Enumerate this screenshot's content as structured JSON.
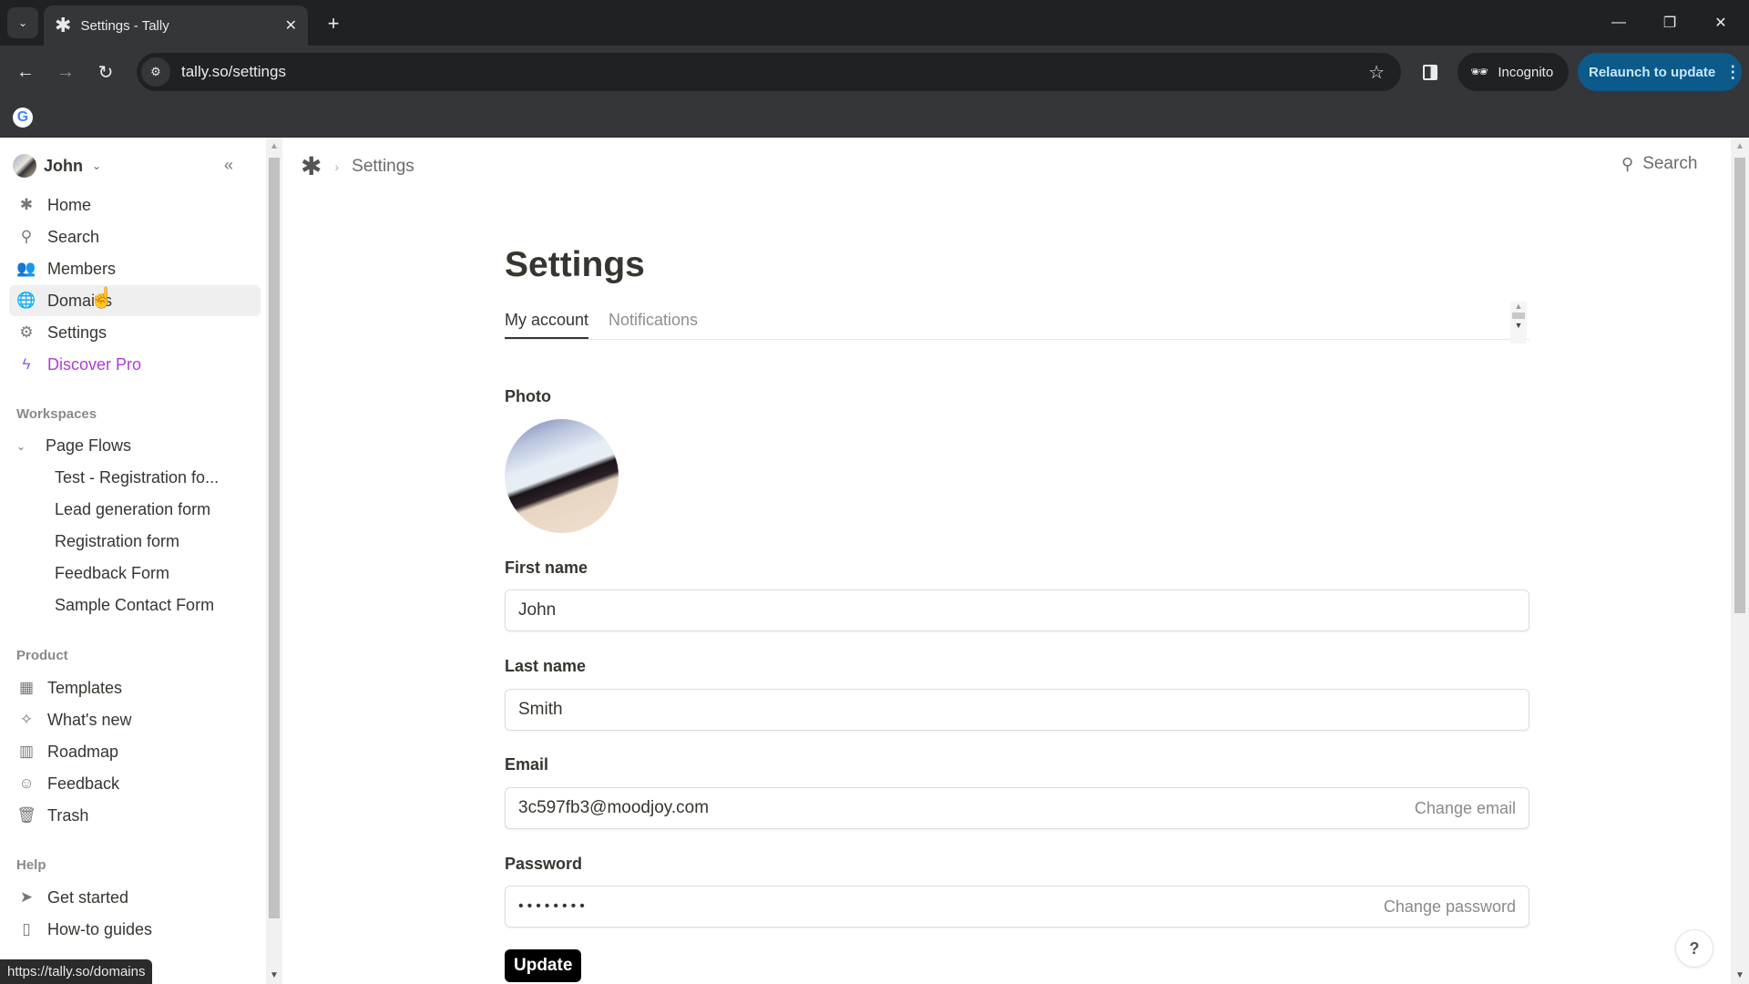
{
  "browser": {
    "tab_title": "Settings - Tally",
    "tab_favicon": "tally-asterisk-icon",
    "url": "tally.so/settings",
    "incognito_label": "Incognito",
    "relaunch_label": "Relaunch to update",
    "status_url": "https://tally.so/domains"
  },
  "sidebar": {
    "workspace_name": "John",
    "nav": [
      {
        "label": "Home",
        "icon": "✱"
      },
      {
        "label": "Search",
        "icon": "⚲"
      },
      {
        "label": "Members",
        "icon": "👥"
      },
      {
        "label": "Domains",
        "icon": "🌐"
      },
      {
        "label": "Settings",
        "icon": "⚙"
      },
      {
        "label": "Discover Pro",
        "icon": "ϟ"
      }
    ],
    "workspaces_label": "Workspaces",
    "workspace_group": "Page Flows",
    "forms": [
      "Test - Registration fo...",
      "Lead generation form",
      "Registration form",
      "Feedback Form",
      "Sample Contact Form"
    ],
    "product_label": "Product",
    "product_items": [
      {
        "label": "Templates",
        "icon": "▦"
      },
      {
        "label": "What's new",
        "icon": "✧"
      },
      {
        "label": "Roadmap",
        "icon": "▥"
      },
      {
        "label": "Feedback",
        "icon": "☺"
      },
      {
        "label": "Trash",
        "icon": "🗑"
      }
    ],
    "help_label": "Help",
    "help_items": [
      {
        "label": "Get started",
        "icon": "➤"
      },
      {
        "label": "How-to guides",
        "icon": "▯"
      }
    ]
  },
  "main": {
    "breadcrumb": "Settings",
    "search_label": "Search",
    "title": "Settings",
    "tabs": [
      "My account",
      "Notifications"
    ],
    "active_tab": "My account",
    "photo_label": "Photo",
    "fields": {
      "first_name": {
        "label": "First name",
        "value": "John"
      },
      "last_name": {
        "label": "Last name",
        "value": "Smith"
      },
      "email": {
        "label": "Email",
        "value": "3c597fb3@moodjoy.com",
        "action": "Change email"
      },
      "password": {
        "label": "Password",
        "value": "••••••••",
        "action": "Change password"
      }
    },
    "update_label": "Update",
    "help_label": "?"
  }
}
